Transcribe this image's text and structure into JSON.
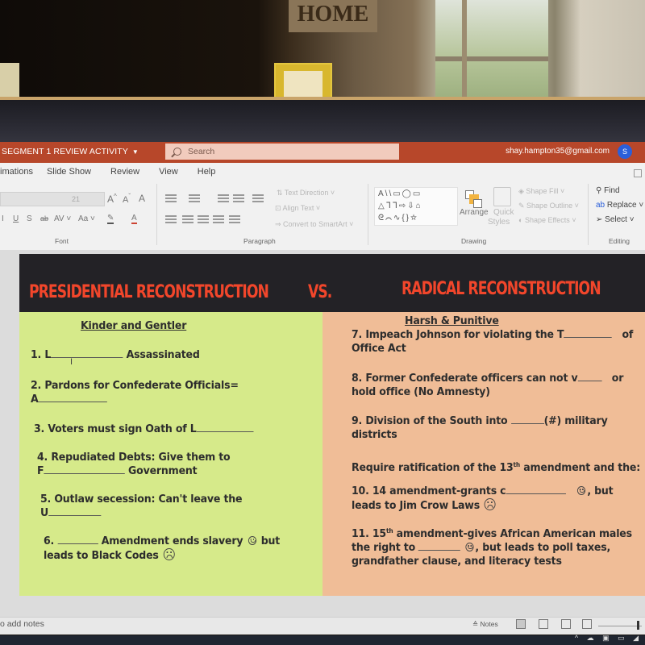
{
  "titlebar": {
    "document_title": "SEGMENT 1 REVIEW ACTIVITY",
    "search_placeholder": "Search",
    "account_email": "shay.hampton35@gmail.com",
    "avatar_initial": "S",
    "accent_color": "#b7472a"
  },
  "menu_tabs": [
    "imations",
    "Slide Show",
    "Review",
    "View",
    "Help"
  ],
  "ribbon": {
    "font": {
      "size_value": "21",
      "buttons": [
        "A^",
        "Aˇ",
        "Clear formatting",
        "I",
        "U",
        "S",
        "ab",
        "AV",
        "Aa",
        "Highlight",
        "Font color"
      ],
      "group_label": "Font"
    },
    "paragraph": {
      "text_direction": "Text Direction",
      "align_text": "Align Text",
      "convert_smartart": "Convert to SmartArt",
      "group_label": "Paragraph"
    },
    "drawing": {
      "shapes_row1": "A\\\\▭◯▭",
      "shapes_row2": "△ᒣᒣ⇨⇩⌂",
      "shapes_row3": "ᘓ⌒∿{}☆",
      "arrange": "Arrange",
      "quick_styles_line1": "Quick",
      "quick_styles_line2": "Styles",
      "shape_fill": "Shape Fill",
      "shape_outline": "Shape Outline",
      "shape_effects": "Shape Effects",
      "group_label": "Drawing"
    },
    "editing": {
      "find": "Find",
      "replace": "Replace",
      "select": "Select",
      "group_label": "Editing"
    }
  },
  "slide": {
    "left_header": "PRESIDENTIAL RECONSTRUCTION",
    "vs": "VS.",
    "right_header": "RADICAL RECONSTRUCTION",
    "colors": {
      "header_bg": "#232226",
      "header_text": "#f2462b",
      "left_bg": "#d6ea8a",
      "right_bg": "#f0bd97"
    },
    "left": {
      "subheading": "Kinder and Gentler",
      "q1_prefix": "1. L",
      "q1_suffix": "Assassinated",
      "q2_line1": "2. Pardons for Confederate Officials=",
      "q2_line2": "A",
      "q3": "3. Voters must sign Oath of L",
      "q4_line1": "4. Repudiated Debts: Give them to",
      "q4_line2_prefix": "F",
      "q4_line2_suffix": "Government",
      "q5_line1": "5. Outlaw secession: Can't leave the",
      "q5_line2": "U",
      "q6_prefix": "6.",
      "q6_mid": "Amendment ends slavery",
      "q6_but": "but",
      "q6_line2": "leads to Black Codes"
    },
    "right": {
      "subheading": "Harsh & Punitive",
      "q7_line1_prefix": "7. Impeach Johnson for violating the T",
      "q7_of": "of",
      "q7_line2": "Office Act",
      "q8_line1_prefix": "8. Former Confederate officers can not v",
      "q8_or": "or",
      "q8_line2": "hold office (No Amnesty)",
      "q9_line1_prefix": "9. Division of the South into",
      "q9_line1_suffix": "(#) military",
      "q9_line2": "districts",
      "require_prefix": "Require ratification of the 13",
      "require_sup": "th",
      "require_suffix": " amendment and the:",
      "q10_prefix": "10. 14 amendment-grants c",
      "q10_but": ", but",
      "q10_line2": "leads to Jim Crow Laws",
      "q11_prefix": "11. 15",
      "q11_sup": "th",
      "q11_line1_suffix": " amendment-gives African American males",
      "q11_line2_prefix": "the right to",
      "q11_line2_suffix": ", but leads to poll taxes,",
      "q11_line3": "grandfather clause, and literacy tests"
    }
  },
  "statusbar": {
    "notes_hint": "o add notes",
    "notes_button": "Notes"
  }
}
